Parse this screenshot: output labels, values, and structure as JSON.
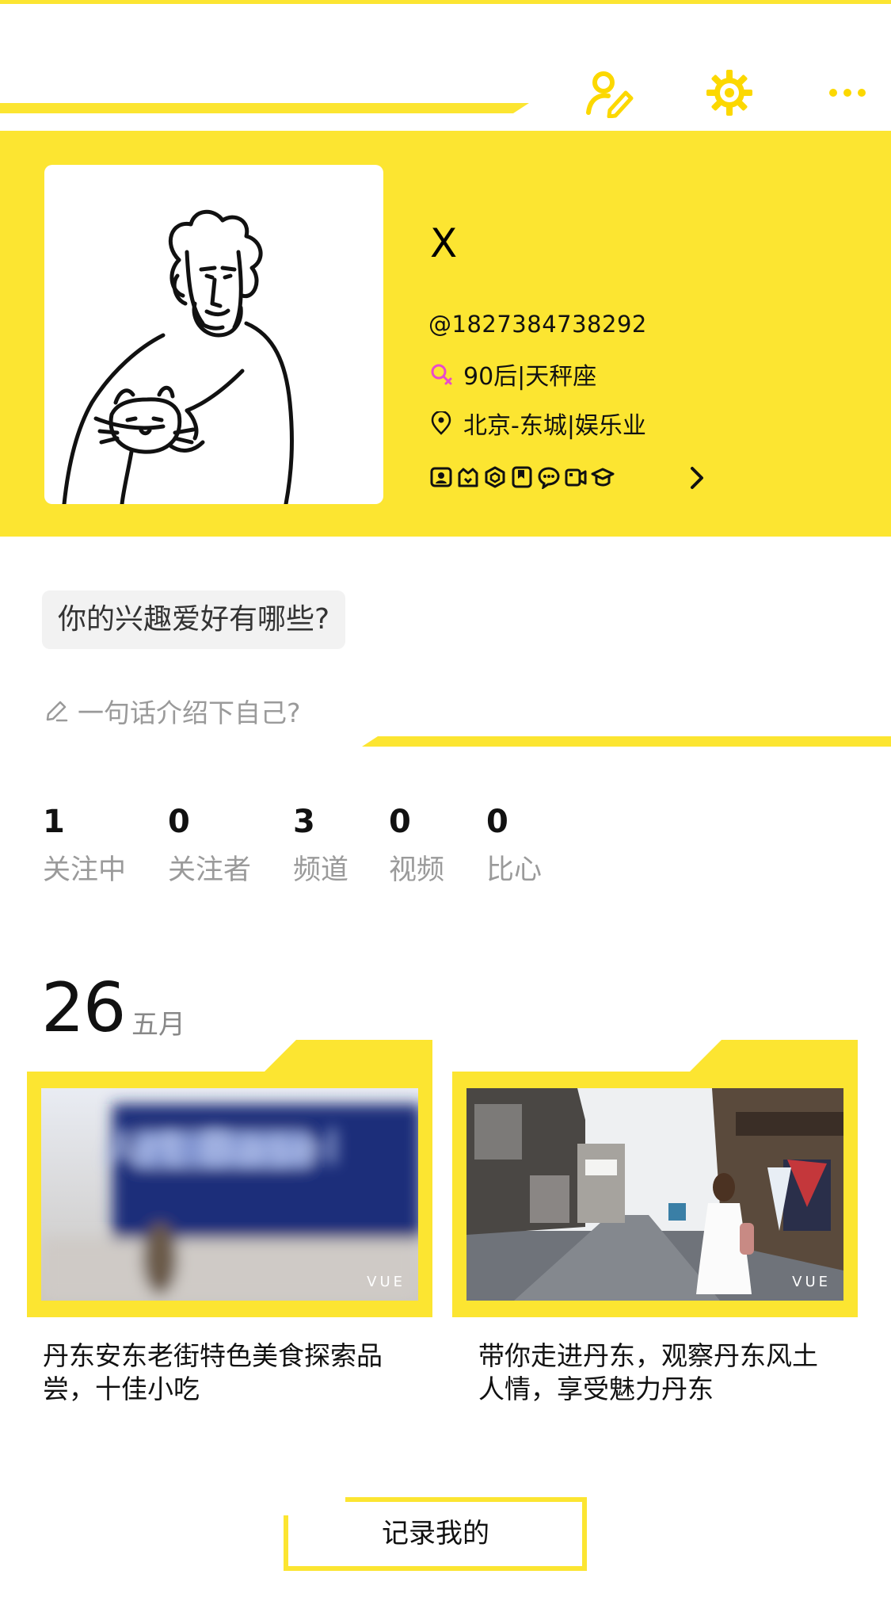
{
  "colors": {
    "accent": "#FCE531",
    "chip_bg": "#f2f2f2",
    "muted": "#9a9a9a"
  },
  "topbar": {
    "icons": [
      "edit-profile-icon",
      "settings-gear-icon",
      "more-dots-icon"
    ]
  },
  "profile": {
    "username": "X",
    "handle": "@1827384738292",
    "age_sign": "90后|天秤座",
    "location": "北京-东城|娱乐业",
    "badges": [
      "badge-1",
      "badge-2",
      "badge-3",
      "badge-4",
      "badge-5",
      "badge-6",
      "badge-7"
    ]
  },
  "interests": {
    "question": "你的兴趣爱好有哪些?",
    "intro_placeholder": "一句话介绍下自己?"
  },
  "stats": [
    {
      "value": "1",
      "label": "关注中"
    },
    {
      "value": "0",
      "label": "关注者"
    },
    {
      "value": "3",
      "label": "频道"
    },
    {
      "value": "0",
      "label": "视频"
    },
    {
      "value": "0",
      "label": "比心"
    }
  ],
  "date": {
    "day": "26",
    "month": "五月"
  },
  "videos": [
    {
      "title": "丹东安东老街特色美食探索品尝，十佳小吃",
      "watermark": "VUE",
      "thumb_text": "Art Basel"
    },
    {
      "title": "带你走进丹东，观察丹东风土人情，享受魅力丹东",
      "watermark": "VUE"
    }
  ],
  "record_button": "记录我的"
}
